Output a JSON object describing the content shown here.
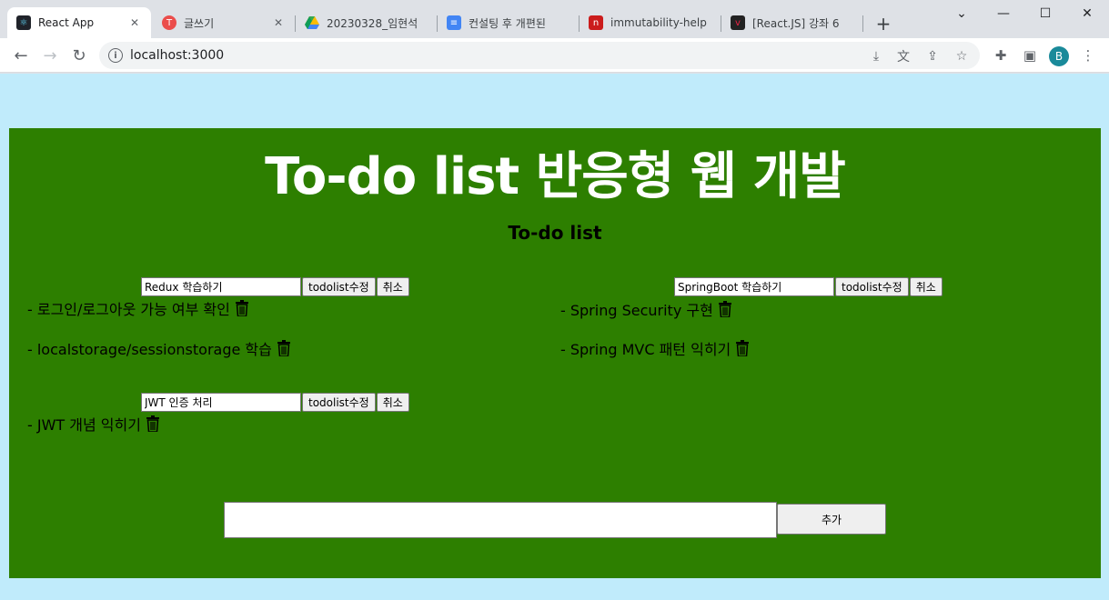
{
  "browser": {
    "tabs": [
      {
        "title": "React App",
        "fav_color": "#20232a",
        "fav_glyph": "⚛"
      },
      {
        "title": "글쓰기",
        "fav_color": "#eb4d4b",
        "fav_glyph": "T"
      },
      {
        "title": "20230328_임현석",
        "fav_color": "#ffffff",
        "fav_glyph": "▲"
      },
      {
        "title": "컨설팅 후 개편된",
        "fav_color": "#4285f4",
        "fav_glyph": "≡"
      },
      {
        "title": "immutability-help",
        "fav_color": "#cb1c1c",
        "fav_glyph": "n"
      },
      {
        "title": "[React.JS] 강좌 6",
        "fav_color": "#222222",
        "fav_glyph": "v"
      }
    ],
    "new_tab": "+",
    "url": "localhost:3000",
    "profile_initial": "B"
  },
  "app": {
    "title": "To-do list 반응형 웹 개발",
    "subtitle": "To-do list",
    "edit_button_label": "todolist수정",
    "cancel_button_label": "취소",
    "groups": [
      {
        "edit_value": "Redux 학습하기",
        "items": [
          "- 로그인/로그아웃 가능 여부 확인",
          "- localstorage/sessionstorage 학습"
        ]
      },
      {
        "edit_value": "SpringBoot 학습하기",
        "items": [
          "- Spring Security 구현",
          "- Spring MVC 패턴 익히기"
        ]
      },
      {
        "edit_value": "JWT 인증 처리",
        "items": [
          "- JWT 개념 익히기"
        ]
      }
    ],
    "add_input_value": "",
    "add_button_label": "추가"
  }
}
